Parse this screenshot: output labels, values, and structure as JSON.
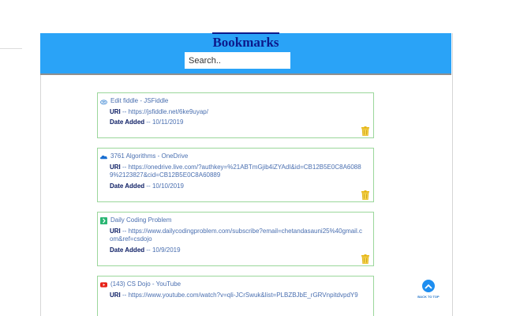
{
  "header": {
    "title": "Bookmarks",
    "search_placeholder": "Search.."
  },
  "labels": {
    "uri": "URI",
    "date_added": "Date Added",
    "separator": "--"
  },
  "bookmarks": [
    {
      "title": "Edit fiddle - JSFiddle",
      "favicon": "jsfiddle-cloud-icon",
      "uri": "https://jsfiddle.net/6ke9uyap/",
      "date_added": "10/11/2019"
    },
    {
      "title": "3761 Algorithms - OneDrive",
      "favicon": "onedrive-cloud-icon",
      "uri": "https://onedrive.live.com/?authkey=%21ABTmGjib4iZYAdI&id=CB12B5E0C8A60889%2123827&cid=CB12B5E0C8A60889",
      "date_added": "10/10/2019"
    },
    {
      "title": "Daily Coding Problem",
      "favicon": "daily-coding-problem-icon",
      "uri": "https://www.dailycodingproblem.com/subscribe?email=chetandasauni25%40gmail.com&ref=csdojo",
      "date_added": "10/9/2019"
    },
    {
      "title": "(143) CS Dojo - YouTube",
      "favicon": "youtube-icon",
      "uri": "https://www.youtube.com/watch?v=qli-JCrSwuk&list=PLBZBJbE_rGRVnpitdvpdY9",
      "date_added": ""
    }
  ],
  "back_to_top": "BACK TO TOP",
  "colors": {
    "header_bg": "#2aa3f7",
    "title": "#0c1a8c",
    "card_border": "#9bd79b",
    "link_text": "#4a6fb0",
    "trash_icon": "#e8b710"
  }
}
